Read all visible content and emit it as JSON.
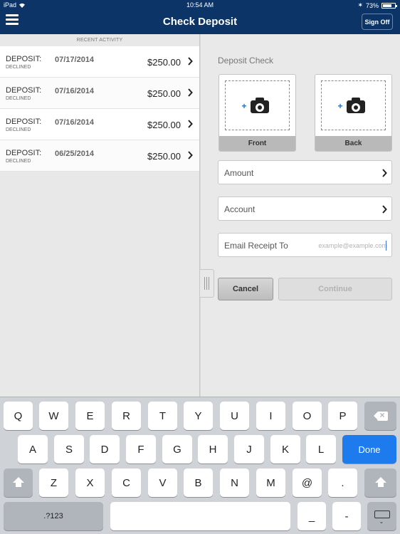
{
  "status_bar": {
    "device": "iPad",
    "time": "10:54 AM",
    "battery": "73%",
    "battery_level": 0.73
  },
  "nav": {
    "title": "Check Deposit",
    "sign_off": "Sign Off"
  },
  "recent": {
    "header": "RECENT ACTIVITY",
    "items": [
      {
        "type": "DEPOSIT:",
        "status": "DECLINED",
        "date": "07/17/2014",
        "amount": "$250.00"
      },
      {
        "type": "DEPOSIT:",
        "status": "DECLINED",
        "date": "07/16/2014",
        "amount": "$250.00"
      },
      {
        "type": "DEPOSIT:",
        "status": "DECLINED",
        "date": "07/16/2014",
        "amount": "$250.00"
      },
      {
        "type": "DEPOSIT:",
        "status": "DECLINED",
        "date": "06/25/2014",
        "amount": "$250.00"
      }
    ]
  },
  "deposit": {
    "title": "Deposit Check",
    "front_label": "Front",
    "back_label": "Back",
    "amount_label": "Amount",
    "account_label": "Account",
    "email_label": "Email Receipt To",
    "email_placeholder": "example@example.com",
    "cancel": "Cancel",
    "continue": "Continue"
  },
  "keyboard": {
    "row1": [
      "Q",
      "W",
      "E",
      "R",
      "T",
      "Y",
      "U",
      "I",
      "O",
      "P"
    ],
    "row2": [
      "A",
      "S",
      "D",
      "F",
      "G",
      "H",
      "J",
      "K",
      "L"
    ],
    "row3": [
      "Z",
      "X",
      "C",
      "V",
      "B",
      "N",
      "M",
      "@",
      "."
    ],
    "done": "Done",
    "numbers": ".?123",
    "underscore": "_",
    "dash": "-"
  },
  "colors": {
    "nav_bg": "#0c3466",
    "done_key": "#1d7bee",
    "camera_plus": "#1b72c9"
  }
}
